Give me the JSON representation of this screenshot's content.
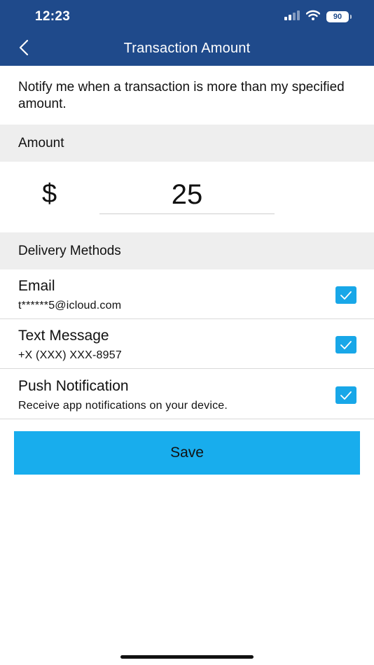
{
  "status_bar": {
    "time": "12:23",
    "battery": "90"
  },
  "nav": {
    "title": "Transaction Amount",
    "back_icon": "chevron-left-icon"
  },
  "intro_text": "Notify me when a transaction is more than my specified amount.",
  "amount_section": {
    "header": "Amount",
    "currency_symbol": "$",
    "value": "25"
  },
  "delivery_section": {
    "header": "Delivery Methods",
    "methods": [
      {
        "title": "Email",
        "detail": "t******5@icloud.com",
        "checked": true
      },
      {
        "title": "Text Message",
        "detail": "+X (XXX) XXX-8957",
        "checked": true
      },
      {
        "title": "Push Notification",
        "detail": "Receive app notifications on your device.",
        "checked": true
      }
    ]
  },
  "save_button": {
    "label": "Save"
  },
  "colors": {
    "nav_bar": "#1f4a8b",
    "accent": "#18aded",
    "section_bg": "#eeeeee"
  }
}
